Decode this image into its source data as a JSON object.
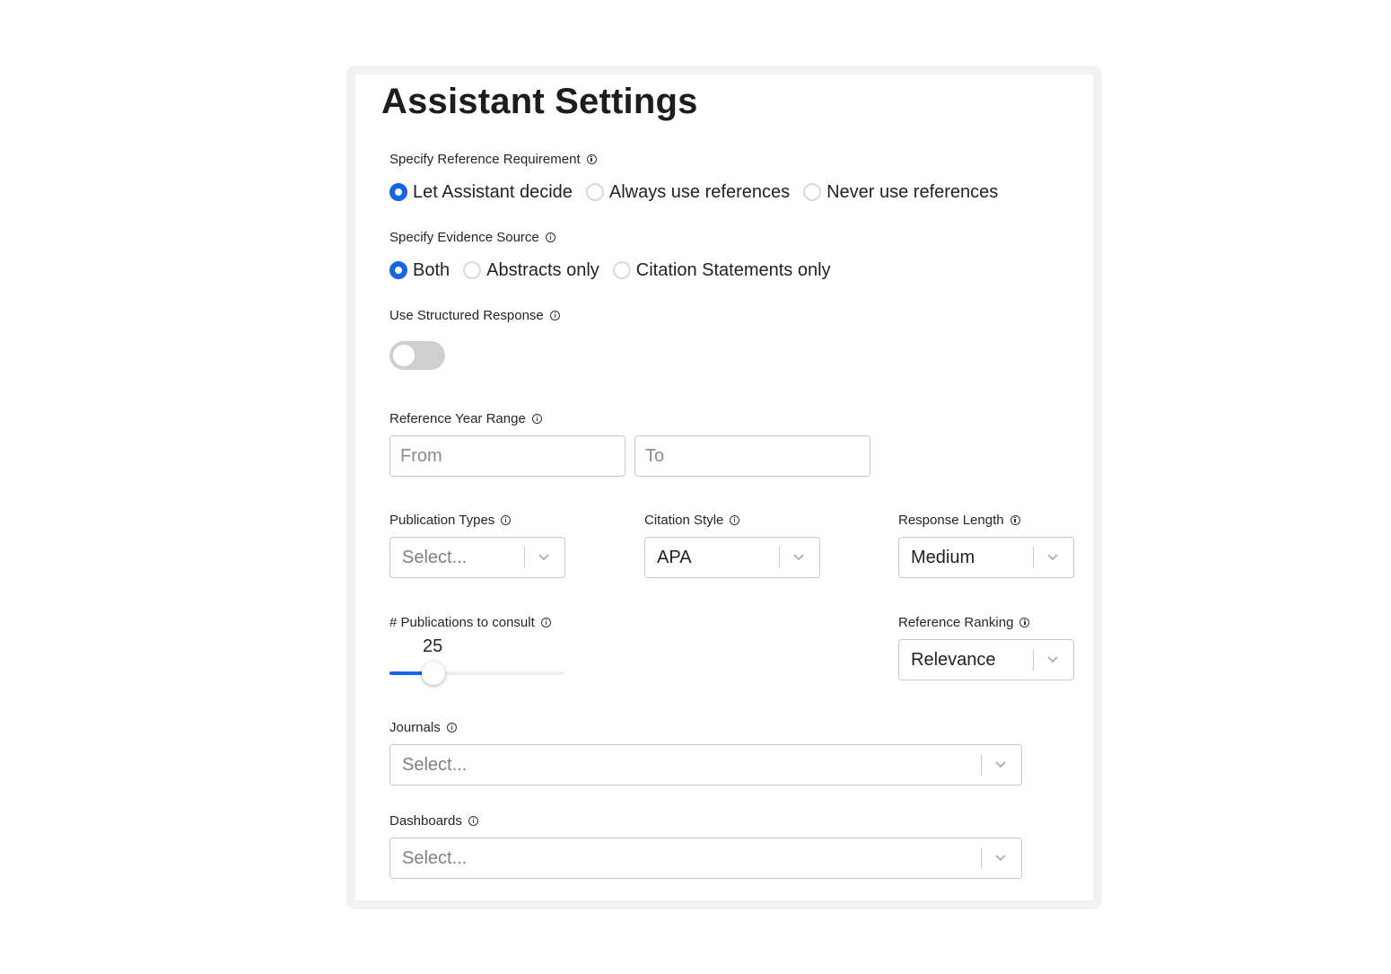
{
  "title": "Assistant Settings",
  "reference_requirement": {
    "label": "Specify Reference Requirement",
    "options": [
      "Let Assistant decide",
      "Always use references",
      "Never use references"
    ],
    "selected": "Let Assistant decide"
  },
  "evidence_source": {
    "label": "Specify Evidence Source",
    "options": [
      "Both",
      "Abstracts only",
      "Citation Statements only"
    ],
    "selected": "Both"
  },
  "structured_response": {
    "label": "Use Structured Response",
    "enabled": false
  },
  "year_range": {
    "label": "Reference Year Range",
    "from_placeholder": "From",
    "to_placeholder": "To"
  },
  "publication_types": {
    "label": "Publication Types",
    "value": "Select..."
  },
  "citation_style": {
    "label": "Citation Style",
    "value": "APA"
  },
  "response_length": {
    "label": "Response Length",
    "value": "Medium"
  },
  "publications_to_consult": {
    "label": "# Publications to consult",
    "value": "25",
    "fill_fraction": 0.25
  },
  "reference_ranking": {
    "label": "Reference Ranking",
    "value": "Relevance"
  },
  "journals": {
    "label": "Journals",
    "value": "Select..."
  },
  "dashboards": {
    "label": "Dashboards",
    "value": "Select..."
  },
  "colors": {
    "accent": "#1366e8",
    "toggle_off": "#cfcfcf"
  },
  "icons": {
    "info": "info-circle-icon",
    "dropdown": "chevron-down-icon"
  }
}
